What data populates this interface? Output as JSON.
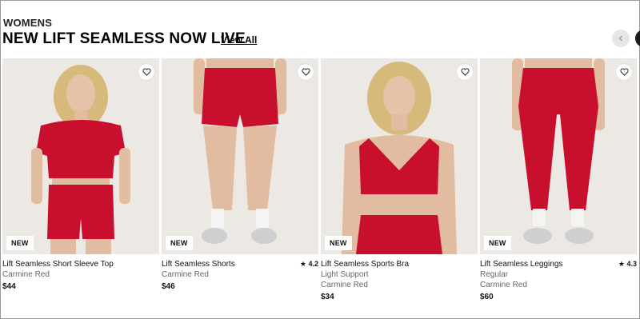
{
  "section": {
    "kicker": "WOMENS",
    "headline": "NEW LIFT SEAMLESS NOW LIVE",
    "view_all": "View All"
  },
  "carousel": {
    "prev_icon": "chevron-left-icon",
    "next_icon": "chevron-right-icon"
  },
  "colors": {
    "accent_red": "#c8102e",
    "image_bg": "#ece8e4"
  },
  "products": [
    {
      "name": "Lift Seamless Short Sleeve Top",
      "lines": [
        "Carmine Red"
      ],
      "price": "$44",
      "rating": "",
      "badge": "NEW"
    },
    {
      "name": "Lift Seamless Shorts",
      "lines": [
        "Carmine Red"
      ],
      "price": "$46",
      "rating": "★ 4.2",
      "badge": "NEW"
    },
    {
      "name": "Lift Seamless Sports Bra",
      "lines": [
        "Light Support",
        "Carmine Red"
      ],
      "price": "$34",
      "rating": "",
      "badge": "NEW"
    },
    {
      "name": "Lift Seamless Leggings",
      "lines": [
        "Regular",
        "Carmine Red"
      ],
      "price": "$60",
      "rating": "★ 4.3",
      "badge": "NEW"
    }
  ]
}
